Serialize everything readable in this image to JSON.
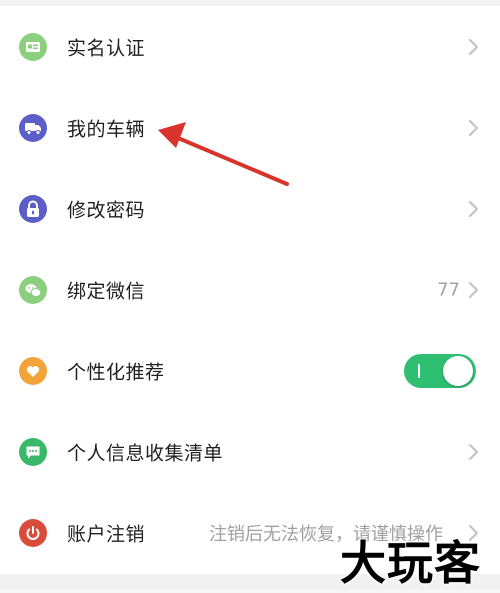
{
  "menu": {
    "items": [
      {
        "label": "实名认证",
        "icon": "id-card-icon",
        "color": "#8ccf7e"
      },
      {
        "label": "我的车辆",
        "icon": "truck-icon",
        "color": "#5b5fc7"
      },
      {
        "label": "修改密码",
        "icon": "lock-icon",
        "color": "#5b5fc7"
      },
      {
        "label": "绑定微信",
        "icon": "wechat-icon",
        "value": "77",
        "color": "#8ccf7e"
      },
      {
        "label": "个性化推荐",
        "icon": "heart-icon",
        "toggle": true,
        "color": "#f2a33a"
      },
      {
        "label": "个人信息收集清单",
        "icon": "message-icon",
        "color": "#39b86a"
      },
      {
        "label": "账户注销",
        "icon": "power-icon",
        "note": "注销后无法恢复，请谨慎操作",
        "color": "#d94b3a"
      }
    ]
  },
  "accent_color": "#2fbf71",
  "annotation_arrow_color": "#d9342b",
  "watermark": "大玩客"
}
